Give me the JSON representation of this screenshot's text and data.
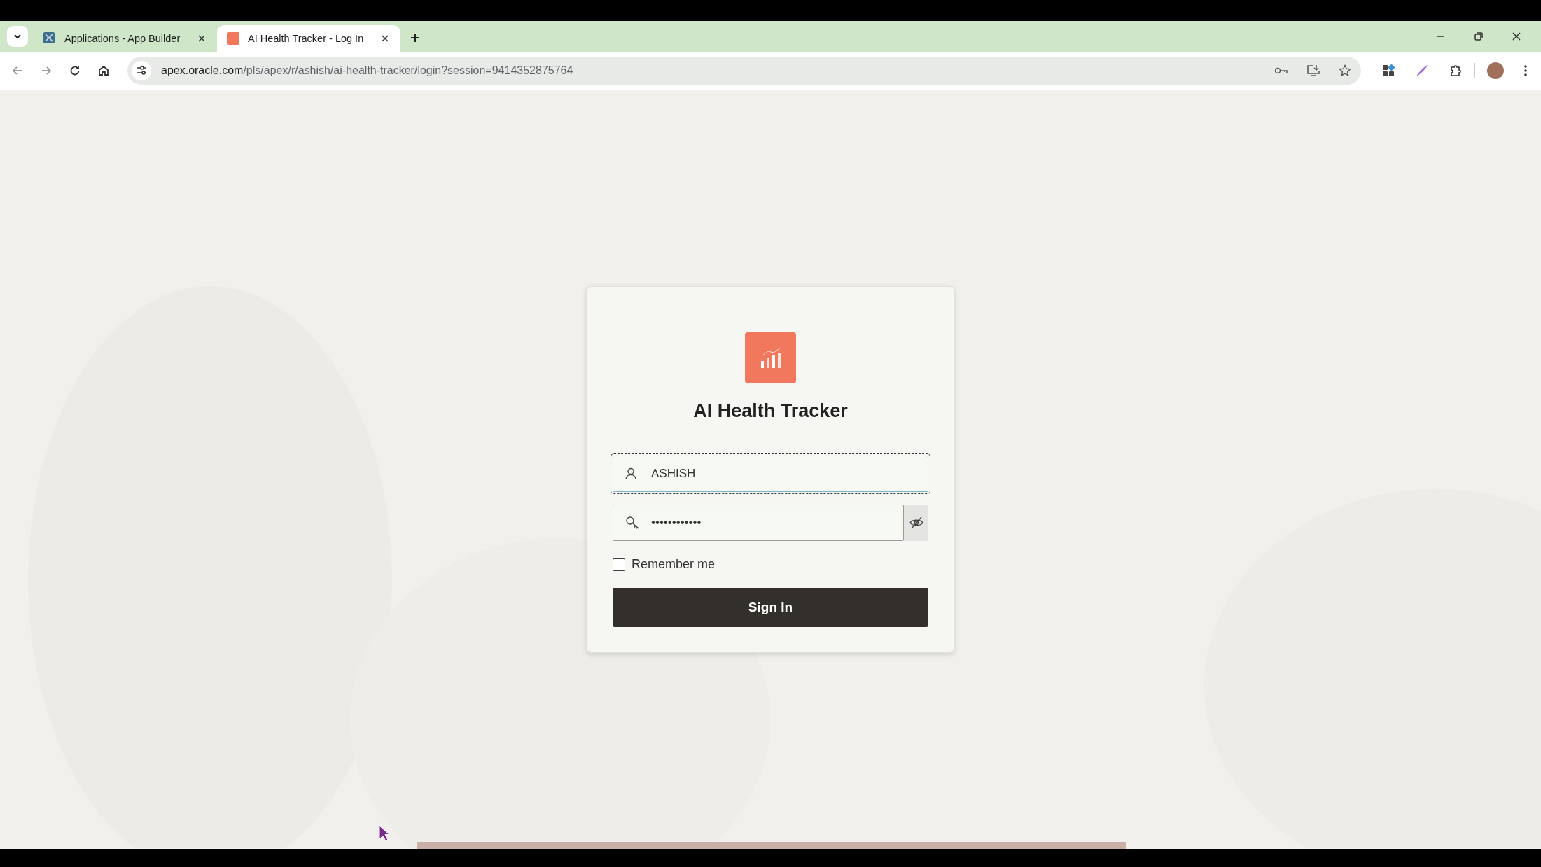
{
  "browser": {
    "tabs": [
      {
        "title": "Applications - App Builder",
        "selected": false,
        "kind": "builder"
      },
      {
        "title": "AI Health Tracker - Log In",
        "selected": true,
        "kind": "app"
      }
    ],
    "address": {
      "host": "apex.oracle.com",
      "path": "/pls/apex/r/ashish/ai-health-tracker/login?session=9414352875764"
    }
  },
  "login": {
    "title": "AI Health Tracker",
    "username": {
      "value": "ASHISH",
      "focused": true
    },
    "password": {
      "value": "••••••••••••"
    },
    "remember": {
      "label": "Remember me",
      "checked": false
    },
    "button": "Sign In"
  }
}
